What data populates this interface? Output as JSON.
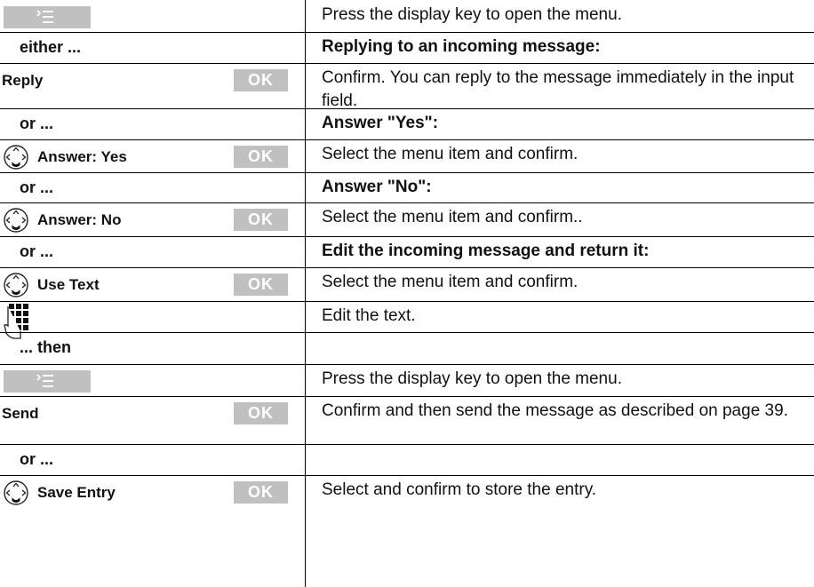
{
  "colors": {
    "softkey_bg": "#c0c0c0",
    "text": "#111111",
    "rule": "#000000"
  },
  "icons": {
    "menu": "menu-softkey-icon",
    "nav": "nav-key-icon",
    "keypad": "keypad-icon"
  },
  "rows": [
    {
      "left_type": "menu",
      "right": "Press the display key to open the menu."
    },
    {
      "left_type": "conj",
      "left": "either ...",
      "right": "Replying to an incoming message:",
      "right_bold": true
    },
    {
      "left_type": "plain",
      "left": "Reply",
      "ok": "OK",
      "right": "Confirm. You can reply to the message immediately in the input field."
    },
    {
      "left_type": "conj",
      "left": "or ...",
      "right": "Answer \"Yes\":",
      "right_bold": true
    },
    {
      "left_type": "nav",
      "left": "Answer: Yes",
      "ok": "OK",
      "right": "Select the menu item and confirm."
    },
    {
      "left_type": "conj",
      "left": "or ...",
      "right": "Answer \"No\":",
      "right_bold": true
    },
    {
      "left_type": "nav",
      "left": "Answer: No",
      "ok": "OK",
      "right": "Select the menu item and confirm.."
    },
    {
      "left_type": "conj",
      "left": "or ...",
      "right": "Edit the incoming message and return it:",
      "right_bold": true
    },
    {
      "left_type": "nav",
      "left": "Use Text",
      "ok": "OK",
      "right": "Select the menu item and confirm."
    },
    {
      "left_type": "keypad",
      "right": "Edit the text."
    },
    {
      "left_type": "conj",
      "left": "... then",
      "right": ""
    },
    {
      "left_type": "menu",
      "right": "Press the display key to open the menu."
    },
    {
      "left_type": "plain",
      "left": "Send",
      "ok": "OK",
      "right": "Confirm and then send the message as described on page 39."
    },
    {
      "left_type": "conj",
      "left": "or ...",
      "right": ""
    },
    {
      "left_type": "nav",
      "left": "Save Entry",
      "ok": "OK",
      "right": "Select and confirm to store the entry."
    }
  ]
}
